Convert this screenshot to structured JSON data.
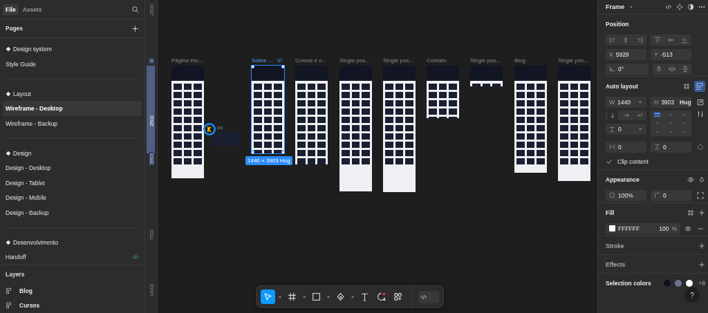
{
  "left_panel": {
    "tabs": [
      {
        "label": "File",
        "selected": true
      },
      {
        "label": "Assets",
        "selected": false
      }
    ],
    "pages_title": "Pages",
    "pages": [
      {
        "kind": "section",
        "label": "Design system"
      },
      {
        "kind": "page",
        "label": "Style Guide",
        "selected": false,
        "dev": false
      },
      {
        "kind": "divider"
      },
      {
        "kind": "section",
        "label": "Layout"
      },
      {
        "kind": "page",
        "label": "Wireframe - Desktop",
        "selected": true,
        "dev": false
      },
      {
        "kind": "page",
        "label": "Wireframe - Backup",
        "selected": false,
        "dev": false
      },
      {
        "kind": "divider"
      },
      {
        "kind": "section",
        "label": "Design"
      },
      {
        "kind": "page",
        "label": "Design - Desktop",
        "selected": false,
        "dev": false
      },
      {
        "kind": "page",
        "label": "Design - Tablet",
        "selected": false,
        "dev": false
      },
      {
        "kind": "page",
        "label": "Design - Mobile",
        "selected": false,
        "dev": false
      },
      {
        "kind": "page",
        "label": "Design - Backup",
        "selected": false,
        "dev": false
      },
      {
        "kind": "divider"
      },
      {
        "kind": "section",
        "label": "Desenvolvimento"
      },
      {
        "kind": "page",
        "label": "Handoff",
        "selected": false,
        "dev": true
      }
    ],
    "layers_title": "Layers",
    "layers": [
      {
        "label": "Blog"
      },
      {
        "label": "Cursos"
      }
    ]
  },
  "canvas": {
    "ruler": [
      {
        "label": "-2500",
        "selected": false
      },
      {
        "label": "0",
        "selected": true
      },
      {
        "label": "2500",
        "selected": false
      },
      {
        "label": "3903",
        "selected": true
      },
      {
        "label": "7500",
        "selected": false
      },
      {
        "label": "10000",
        "selected": false
      }
    ],
    "frames": [
      {
        "label": "Página inic...",
        "selected": false
      },
      {
        "label": "Sobre ...",
        "selected": true
      },
      {
        "label": "Cursos e n...",
        "selected": false
      },
      {
        "label": "Single pos...",
        "selected": false
      },
      {
        "label": "Single pos...",
        "selected": false
      },
      {
        "label": "Contato",
        "selected": false
      },
      {
        "label": "Single pos...",
        "selected": false
      },
      {
        "label": "Blog",
        "selected": false
      },
      {
        "label": "Single pos...",
        "selected": false
      }
    ],
    "selection_size": "1440 × 3903 Hug",
    "collaborator_label": "os"
  },
  "toolbar": {
    "tools": [
      {
        "kind": "move",
        "selected": true,
        "menu": true
      },
      {
        "kind": "frame",
        "selected": false,
        "menu": true
      },
      {
        "kind": "shape",
        "selected": false,
        "menu": true
      },
      {
        "kind": "pen",
        "selected": false,
        "menu": true
      },
      {
        "kind": "text",
        "selected": false,
        "menu": false
      },
      {
        "kind": "comment",
        "selected": false,
        "menu": false
      },
      {
        "kind": "actions",
        "selected": false,
        "menu": false
      }
    ],
    "dev_mode": {
      "on": false
    }
  },
  "inspector": {
    "title": "Frame",
    "position": {
      "title": "Position",
      "x": {
        "label": "X",
        "value": "5929"
      },
      "y": {
        "label": "Y",
        "value": "-513"
      },
      "rotation": {
        "value": "0°"
      }
    },
    "auto_layout": {
      "title": "Auto layout",
      "on": true,
      "width": {
        "label": "W",
        "value": "1440"
      },
      "height": {
        "label": "H",
        "value": "3903",
        "mode": "Hug"
      },
      "direction": [
        {
          "kind": "vertical",
          "selected": true
        },
        {
          "kind": "horizontal",
          "selected": false
        },
        {
          "kind": "wrap",
          "selected": false
        }
      ],
      "alignment": [
        {
          "selected": true
        },
        {
          "selected": false
        },
        {
          "selected": false
        },
        {
          "selected": false
        },
        {
          "selected": false
        },
        {
          "selected": false
        },
        {
          "selected": false
        },
        {
          "selected": false
        },
        {
          "selected": false
        }
      ],
      "gap": {
        "value": "0"
      },
      "padding_horizontal": {
        "value": "0"
      },
      "padding_vertical": {
        "value": "0"
      },
      "clip_content": {
        "label": "Clip content",
        "checked": true
      }
    },
    "appearance": {
      "title": "Appearance",
      "opacity": "100%",
      "corner_radius": "0"
    },
    "fill": {
      "title": "Fill",
      "hex": "FFFFFF",
      "opacity": "100",
      "unit": "%"
    },
    "stroke": {
      "title": "Stroke"
    },
    "effects": {
      "title": "Effects"
    },
    "selection_colors": {
      "title": "Selection colors",
      "colors": [
        {
          "color": "#0e1023"
        },
        {
          "color": "#6b7391"
        },
        {
          "color": "#ffffff"
        }
      ],
      "more": "+8"
    }
  },
  "help": {
    "label": "?"
  }
}
